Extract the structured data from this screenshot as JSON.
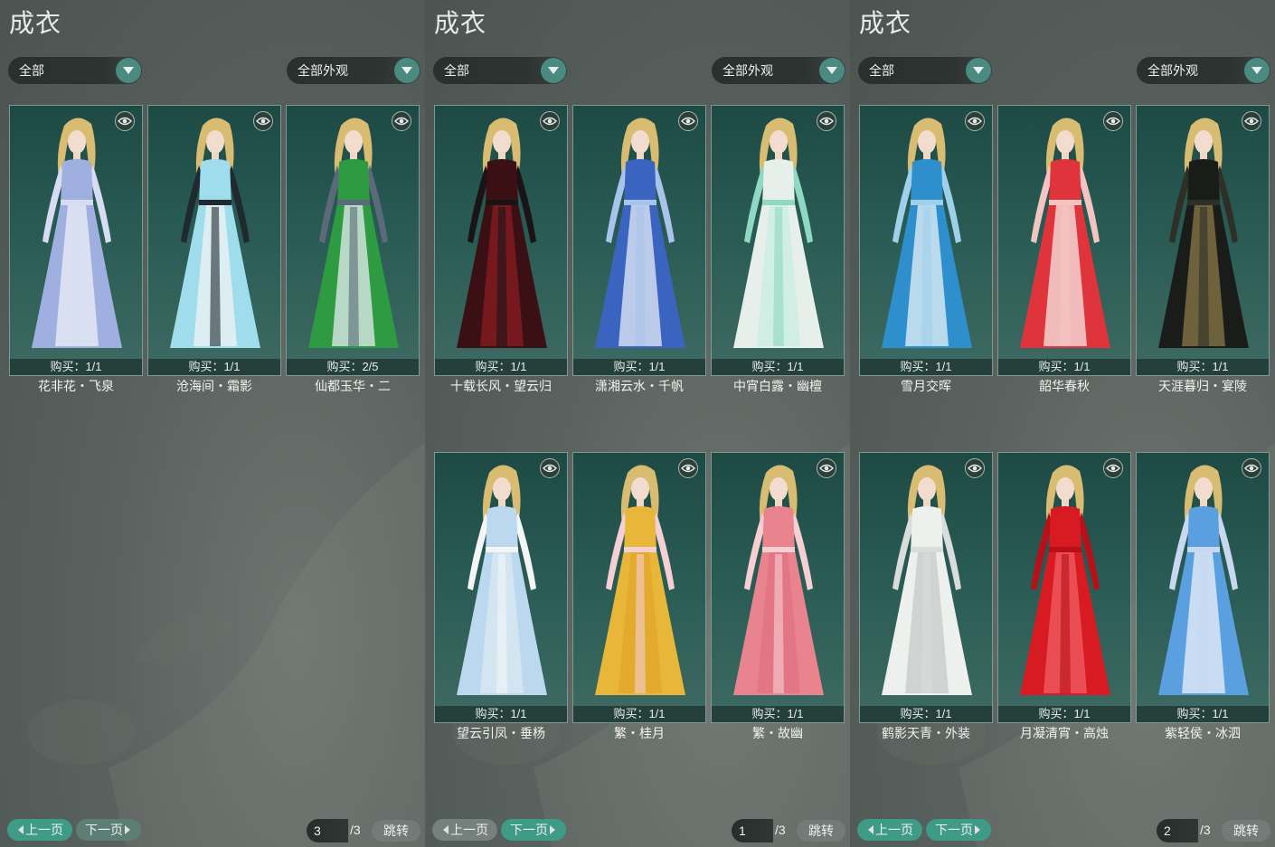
{
  "panels": [
    {
      "title": "成衣",
      "filter": "全部",
      "appearance_filter": "全部外观",
      "prev_label": "上一页",
      "next_label": "下一页",
      "page": "1",
      "total": "/3",
      "jump_label": "跳转",
      "items": [
        {
          "buy": "购买：1/1",
          "name": "十载长风・望云归",
          "colors": [
            "#3a1014",
            "#1a1416",
            "#8a1c22"
          ]
        },
        {
          "buy": "购买：1/1",
          "name": "潇湘云水・千帆",
          "colors": [
            "#3a64c0",
            "#a9c4ea",
            "#e9eef8"
          ]
        },
        {
          "buy": "购买：1/1",
          "name": "中宵白露・幽檀",
          "colors": [
            "#e6efe9",
            "#8fd8c4",
            "#c8eee2"
          ]
        },
        {
          "buy": "购买：1/1",
          "name": "望云引凤・垂杨",
          "colors": [
            "#bcd8ee",
            "#f4f6f6",
            "#dbe9f2"
          ]
        },
        {
          "buy": "购买：1/1",
          "name": "繁・桂月",
          "colors": [
            "#e8b638",
            "#f4cfd4",
            "#e2a52a"
          ]
        },
        {
          "buy": "购买：1/1",
          "name": "繁・故幽",
          "colors": [
            "#e9848e",
            "#f6cfd2",
            "#e07280"
          ]
        }
      ]
    },
    {
      "title": "成衣",
      "filter": "全部",
      "appearance_filter": "全部外观",
      "prev_label": "上一页",
      "next_label": "下一页",
      "page": "2",
      "total": "/3",
      "jump_label": "跳转",
      "items": [
        {
          "buy": "购买：1/1",
          "name": "雪月交晖",
          "colors": [
            "#2f8fcc",
            "#9fd0ea",
            "#e8f2f8"
          ]
        },
        {
          "buy": "购买：1/1",
          "name": "韶华春秋",
          "colors": [
            "#e0343c",
            "#f4c4c2",
            "#f8e8e6"
          ]
        },
        {
          "buy": "购买：1/1",
          "name": "天涯暮归・宴陵",
          "colors": [
            "#1a1c1a",
            "#2e3028",
            "#8a7a48"
          ]
        },
        {
          "buy": "购买：1/1",
          "name": "鹤影天青・外装",
          "colors": [
            "#eef0ee",
            "#d8dcda",
            "#c4cac8"
          ]
        },
        {
          "buy": "购买：1/1",
          "name": "月凝清宵・高烛",
          "colors": [
            "#d81a22",
            "#b80f18",
            "#f06066"
          ]
        },
        {
          "buy": "购买：1/1",
          "name": "紫轻侯・冰泗",
          "colors": [
            "#5aa0e0",
            "#c8d8ee",
            "#eef2f8"
          ]
        }
      ]
    },
    {
      "title": "成衣",
      "filter": "全部",
      "appearance_filter": "全部外观",
      "prev_label": "上一页",
      "next_label": "下一页",
      "page": "3",
      "total": "/3",
      "jump_label": "跳转",
      "items": [
        {
          "buy": "购买：1/1",
          "name": "花非花・飞泉",
          "colors": [
            "#9fb0e0",
            "#d6ddf2",
            "#eef0f8"
          ]
        },
        {
          "buy": "购买：1/1",
          "name": "沧海间・霜影",
          "colors": [
            "#9fdcec",
            "#1e2a30",
            "#f0f4f4"
          ]
        },
        {
          "buy": "购买：2/5",
          "name": "仙都玉华・二",
          "colors": [
            "#2e9a42",
            "#5a6a7a",
            "#e6ecf0"
          ]
        }
      ]
    }
  ]
}
